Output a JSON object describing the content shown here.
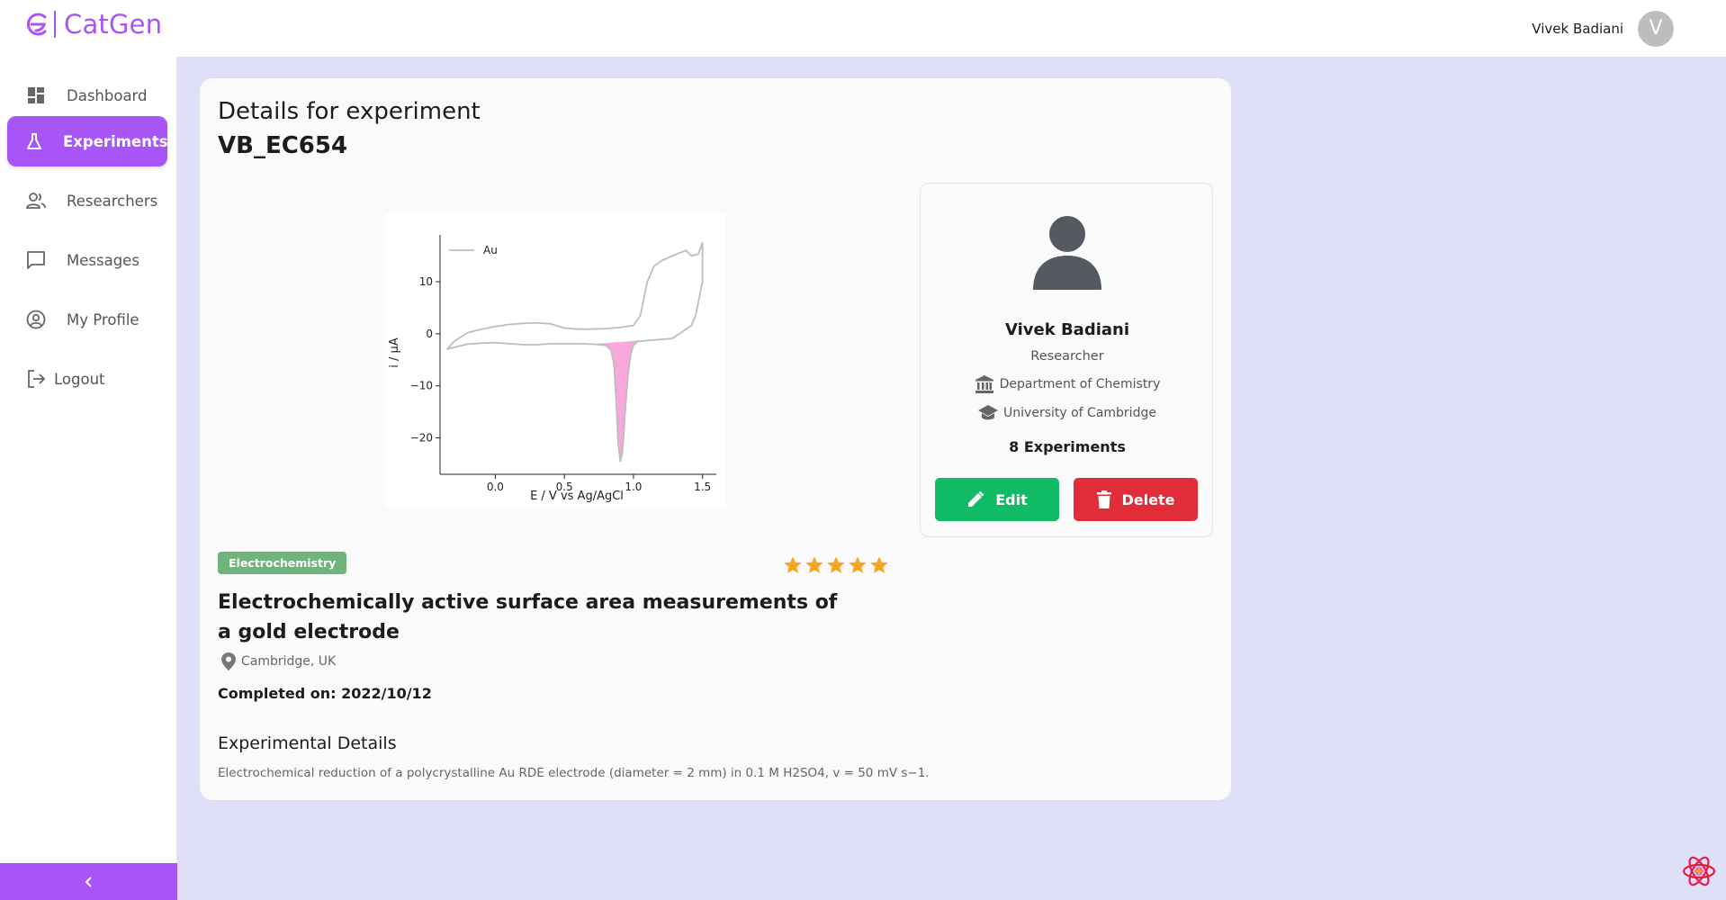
{
  "app": {
    "name": "CatGen"
  },
  "user": {
    "name": "Vivek Badiani",
    "initial": "V"
  },
  "sidebar": {
    "items": [
      {
        "label": "Dashboard",
        "icon": "dashboard-icon"
      },
      {
        "label": "Experiments",
        "icon": "flask-icon",
        "active": true
      },
      {
        "label": "Researchers",
        "icon": "people-icon"
      },
      {
        "label": "Messages",
        "icon": "chat-icon"
      },
      {
        "label": "My Profile",
        "icon": "account-circle-icon"
      },
      {
        "label": "Logout",
        "icon": "logout-icon"
      }
    ],
    "collapse_icon": "chevron-left-icon"
  },
  "experiment": {
    "title_prefix": "Details for experiment",
    "id": "VB_EC654",
    "category": "Electrochemistry",
    "rating": 5,
    "title": "Electrochemically active surface area measurements of a gold electrode",
    "location": "Cambridge, UK",
    "completed": "Completed on: 2022/10/12",
    "details_heading": "Experimental Details",
    "details_text": "Electrochemical reduction of a polycrystalline Au RDE electrode (diameter = 2 mm) in 0.1 M H2SO4, v = 50 mV s−1."
  },
  "researcher": {
    "name": "Vivek Badiani",
    "role": "Researcher",
    "department": "Department of Chemistry",
    "university": "University of Cambridge",
    "experiments": "8 Experiments",
    "edit_label": "Edit",
    "delete_label": "Delete"
  },
  "colors": {
    "accent": "#a855f7",
    "background": "#dfe0f8",
    "edit": "#11bb66",
    "delete": "#e12d39",
    "tag": "#6fb47a",
    "star": "#f5a623",
    "curve": "#bdbdbd",
    "fill": "#f8a8dc"
  },
  "chart_data": {
    "type": "line",
    "xlabel": "E / V vs Ag/AgCl",
    "ylabel": "i / µA",
    "xlim": [
      -0.4,
      1.6
    ],
    "ylim": [
      -27,
      19
    ],
    "xticks": [
      0.0,
      0.5,
      1.0,
      1.5
    ],
    "xtick_labels": [
      "0.0",
      "0.5",
      "1.0",
      "1.5"
    ],
    "yticks": [
      10,
      0,
      -10,
      -20
    ],
    "ytick_labels": [
      "10",
      "0",
      "−10",
      "−20"
    ],
    "legend": "top-left",
    "series": [
      {
        "name": "Au",
        "x": [
          -0.35,
          -0.3,
          -0.2,
          -0.1,
          0.0,
          0.1,
          0.2,
          0.3,
          0.4,
          0.5,
          0.6,
          0.7,
          0.8,
          0.9,
          1.0,
          1.05,
          1.1,
          1.15,
          1.2,
          1.3,
          1.38,
          1.42,
          1.47,
          1.5,
          1.5,
          1.45,
          1.42,
          1.35,
          1.28,
          1.2,
          1.1,
          1.03,
          1.0,
          0.98,
          0.96,
          0.94,
          0.92,
          0.905,
          0.89,
          0.875,
          0.86,
          0.84,
          0.8,
          0.7,
          0.6,
          0.5,
          0.4,
          0.3,
          0.2,
          0.1,
          0.0,
          -0.1,
          -0.2,
          -0.3,
          -0.35
        ],
        "y": [
          -3,
          -1.5,
          0.2,
          0.9,
          1.4,
          1.8,
          2.0,
          2.1,
          1.9,
          1.1,
          0.9,
          0.9,
          1.0,
          1.2,
          1.6,
          3.5,
          10.0,
          13.0,
          14.0,
          15.2,
          16.0,
          15.0,
          15.3,
          17.5,
          10.0,
          3.5,
          1.6,
          0.3,
          -0.9,
          -1.1,
          -1.3,
          -1.5,
          -2.2,
          -4.0,
          -8.0,
          -15.0,
          -23.0,
          -24.5,
          -21.0,
          -13.0,
          -6.0,
          -3.2,
          -2.2,
          -2.0,
          -1.9,
          -1.9,
          -1.9,
          -2.1,
          -2.1,
          -1.9,
          -1.7,
          -1.8,
          -2.0,
          -2.6,
          -3.0
        ]
      }
    ],
    "shaded_region": {
      "x_range": [
        0.62,
        1.03
      ],
      "description": "reduction peak area"
    }
  }
}
